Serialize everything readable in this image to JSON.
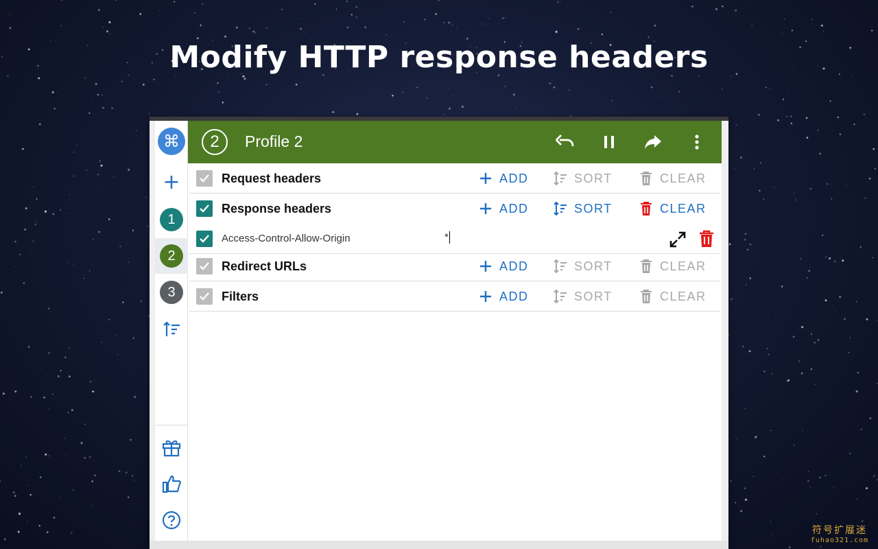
{
  "hero": {
    "title": "Modify HTTP response headers"
  },
  "sidebar": {
    "logo_glyph": "⌘",
    "add_glyph": "+",
    "profiles": [
      {
        "label": "1",
        "color": "#1b7f7b"
      },
      {
        "label": "2",
        "color": "#4d7a23"
      },
      {
        "label": "3",
        "color": "#5a5f64"
      }
    ]
  },
  "header": {
    "profile_number": "2",
    "profile_name": "Profile 2",
    "background": "#4d7a23",
    "icons": [
      "undo-icon",
      "pause-icon",
      "share-icon",
      "more-vert-icon"
    ]
  },
  "sections": [
    {
      "label": "Request headers",
      "enabled": false,
      "add": "ADD",
      "sort": "SORT",
      "clear": "CLEAR",
      "sort_active": false,
      "clear_active": false
    },
    {
      "label": "Response headers",
      "enabled": true,
      "add": "ADD",
      "sort": "SORT",
      "clear": "CLEAR",
      "sort_active": true,
      "clear_active": true
    },
    {
      "label": "Redirect URLs",
      "enabled": false,
      "add": "ADD",
      "sort": "SORT",
      "clear": "CLEAR",
      "sort_active": false,
      "clear_active": false
    },
    {
      "label": "Filters",
      "enabled": false,
      "add": "ADD",
      "sort": "SORT",
      "clear": "CLEAR",
      "sort_active": false,
      "clear_active": false
    }
  ],
  "response_header": {
    "name": "Access-Control-Allow-Origin",
    "value": "*",
    "enabled": true
  },
  "colors": {
    "accent_blue": "#1f6fc2",
    "danger_red": "#e31b1b",
    "teal": "#1b7f7b",
    "disabled_grey": "#a8a8a8"
  },
  "watermark": {
    "cn": "符号扩展迷",
    "url": "fuhao321.com"
  }
}
